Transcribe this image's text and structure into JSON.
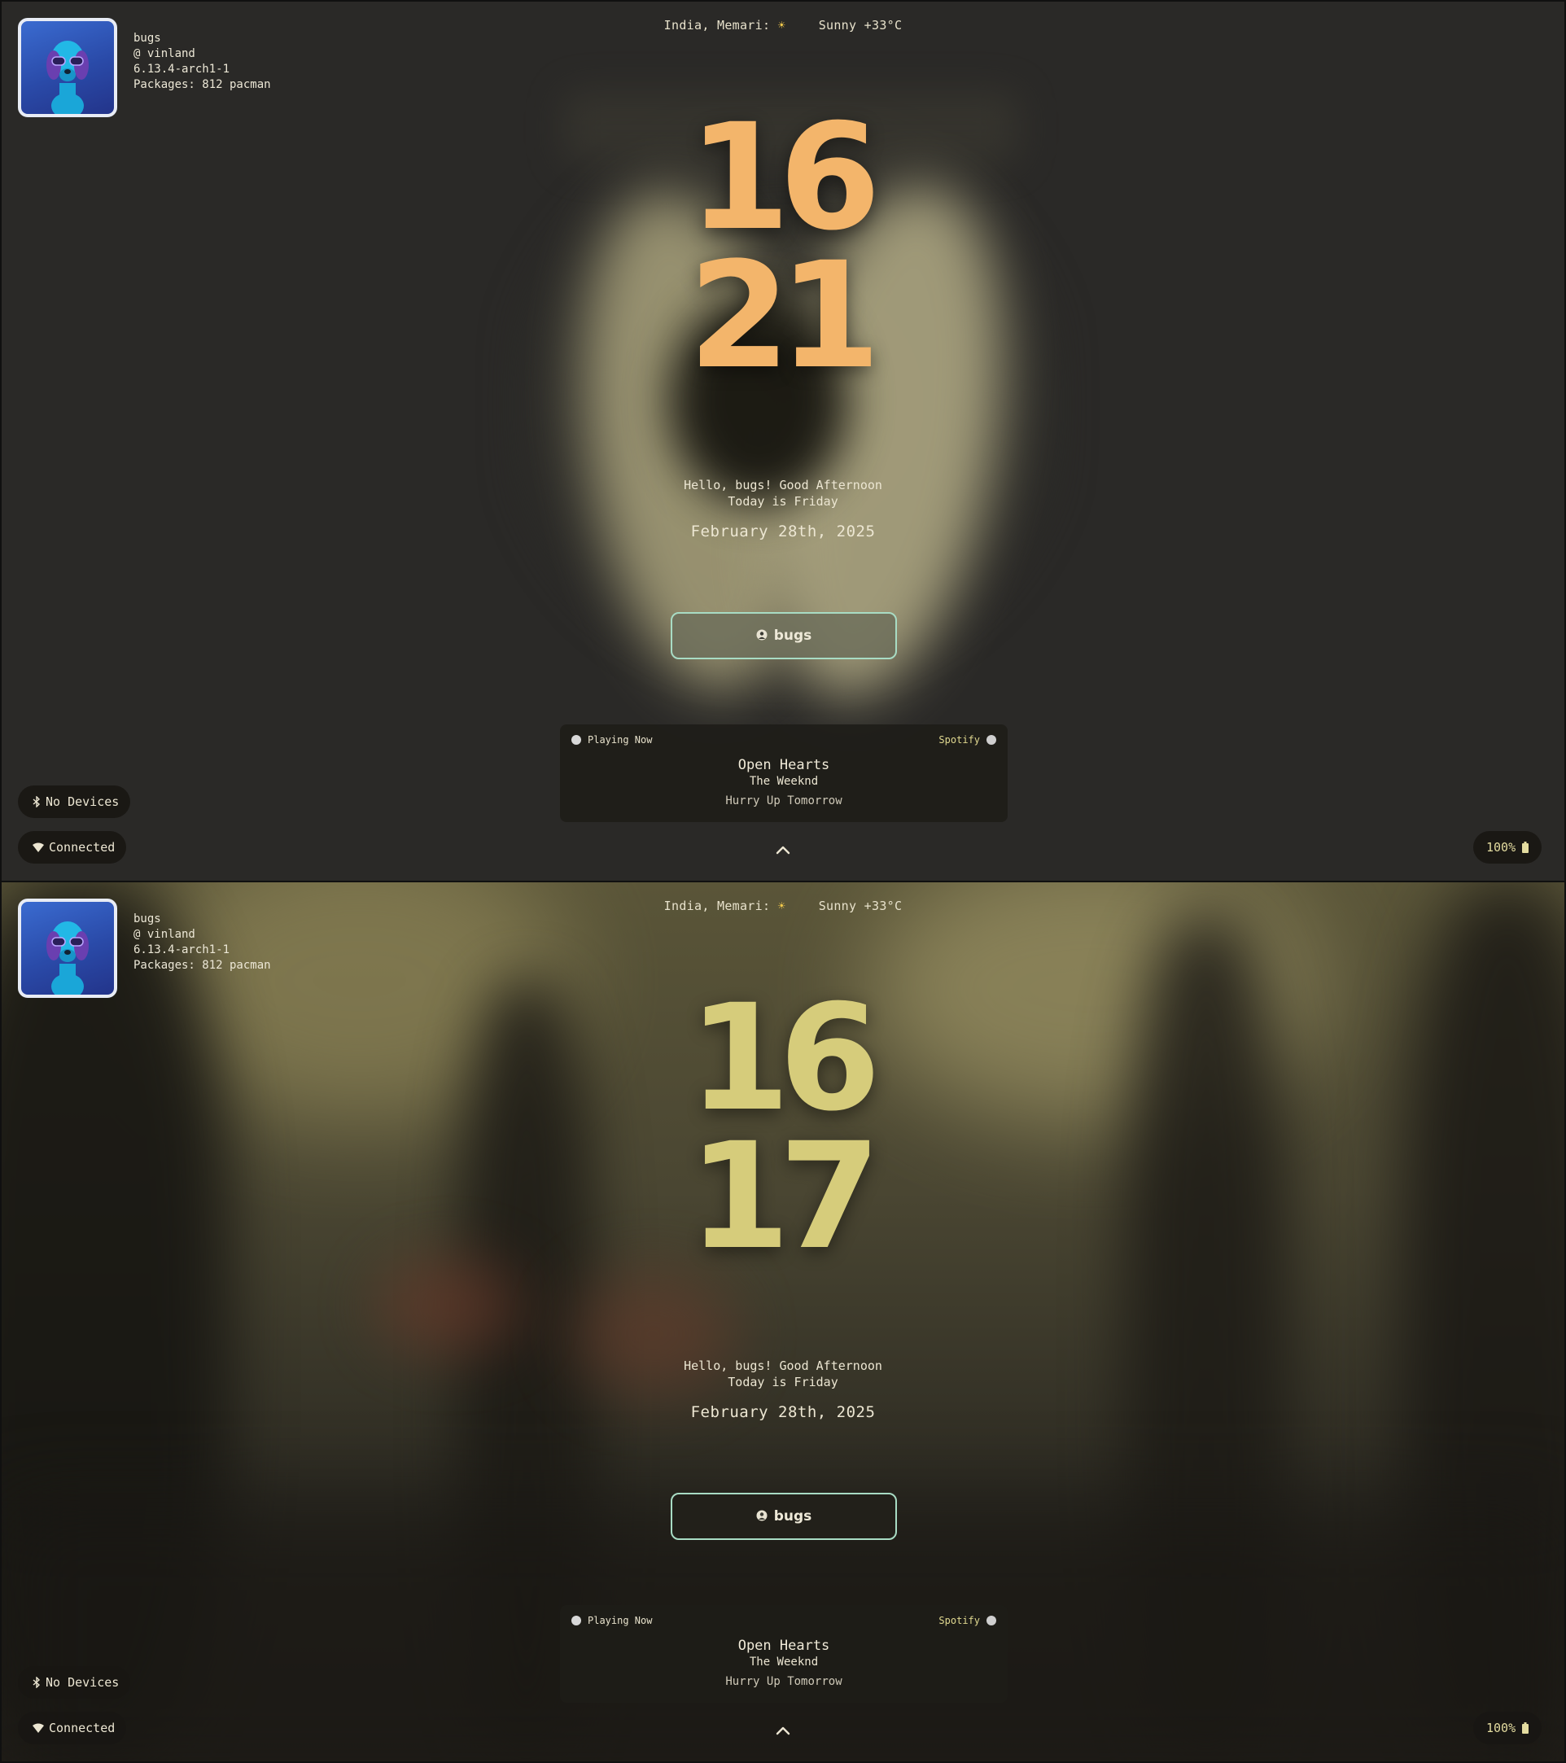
{
  "screens": [
    {
      "profile": {
        "username": "bugs",
        "host": "@ vinland",
        "kernel": "6.13.4-arch1-1",
        "packages": "Packages: 812 pacman"
      },
      "weather": {
        "location": "India, Memari:",
        "condition_icon": "sun-icon",
        "condition": "Sunny +33°C"
      },
      "clock": {
        "hour": "16",
        "minute": "21"
      },
      "greeting": {
        "line1": "Hello, bugs! Good Afternoon",
        "line2": "Today is Friday"
      },
      "date": "February 28th, 2025",
      "user_button": {
        "label": "bugs"
      },
      "player": {
        "status": "Playing Now",
        "source": "Spotify",
        "title": "Open Hearts",
        "artist": "The Weeknd",
        "album": "Hurry Up Tomorrow"
      },
      "bluetooth": {
        "label": "No Devices"
      },
      "network": {
        "label": "Connected"
      },
      "battery": {
        "label": "100%"
      },
      "colors": {
        "clock": "#f3b56b",
        "button_border": "#a8dcc4"
      }
    },
    {
      "profile": {
        "username": "bugs",
        "host": "@ vinland",
        "kernel": "6.13.4-arch1-1",
        "packages": "Packages: 812 pacman"
      },
      "weather": {
        "location": "India, Memari:",
        "condition_icon": "sun-icon",
        "condition": "Sunny +33°C"
      },
      "clock": {
        "hour": "16",
        "minute": "17"
      },
      "greeting": {
        "line1": "Hello, bugs! Good Afternoon",
        "line2": "Today is Friday"
      },
      "date": "February 28th, 2025",
      "user_button": {
        "label": "bugs"
      },
      "player": {
        "status": "Playing Now",
        "source": "Spotify",
        "title": "Open Hearts",
        "artist": "The Weeknd",
        "album": "Hurry Up Tomorrow"
      },
      "bluetooth": {
        "label": "No Devices"
      },
      "network": {
        "label": "Connected"
      },
      "battery": {
        "label": "100%"
      },
      "colors": {
        "clock": "#d6cc7b",
        "button_border": "#a8dcc4"
      }
    }
  ]
}
